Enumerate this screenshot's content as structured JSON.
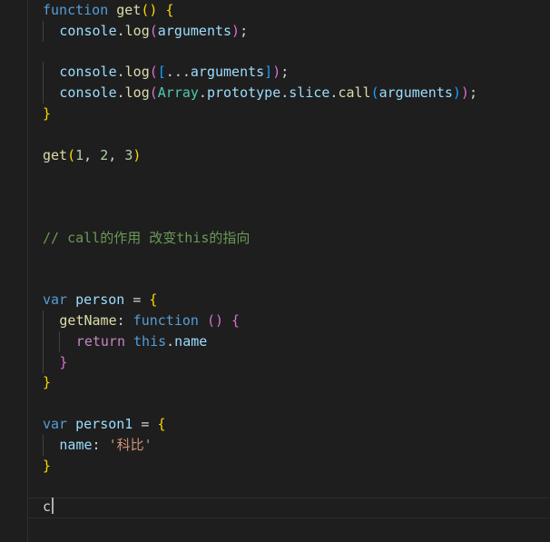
{
  "editor": {
    "language": "javascript",
    "lines": [
      {
        "tokens": [
          {
            "t": "function",
            "c": "kw"
          },
          {
            "t": " ",
            "c": "pl"
          },
          {
            "t": "get",
            "c": "fn"
          },
          {
            "t": "()",
            "c": "p1"
          },
          {
            "t": " ",
            "c": "pl"
          },
          {
            "t": "{",
            "c": "p1"
          }
        ]
      },
      {
        "tokens": [
          {
            "t": "console",
            "c": "var"
          },
          {
            "t": ".",
            "c": "pl"
          },
          {
            "t": "log",
            "c": "fn"
          },
          {
            "t": "(",
            "c": "p2"
          },
          {
            "t": "arguments",
            "c": "var"
          },
          {
            "t": ")",
            "c": "p2"
          },
          {
            "t": ";",
            "c": "pl"
          }
        ]
      },
      {
        "tokens": []
      },
      {
        "tokens": [
          {
            "t": "console",
            "c": "var"
          },
          {
            "t": ".",
            "c": "pl"
          },
          {
            "t": "log",
            "c": "fn"
          },
          {
            "t": "(",
            "c": "p2"
          },
          {
            "t": "[",
            "c": "p3"
          },
          {
            "t": "...",
            "c": "pl"
          },
          {
            "t": "arguments",
            "c": "var"
          },
          {
            "t": "]",
            "c": "p3"
          },
          {
            "t": ")",
            "c": "p2"
          },
          {
            "t": ";",
            "c": "pl"
          }
        ]
      },
      {
        "tokens": [
          {
            "t": "console",
            "c": "var"
          },
          {
            "t": ".",
            "c": "pl"
          },
          {
            "t": "log",
            "c": "fn"
          },
          {
            "t": "(",
            "c": "p2"
          },
          {
            "t": "Array",
            "c": "type"
          },
          {
            "t": ".",
            "c": "pl"
          },
          {
            "t": "prototype",
            "c": "var"
          },
          {
            "t": ".",
            "c": "pl"
          },
          {
            "t": "slice",
            "c": "var"
          },
          {
            "t": ".",
            "c": "pl"
          },
          {
            "t": "call",
            "c": "fn"
          },
          {
            "t": "(",
            "c": "p3"
          },
          {
            "t": "arguments",
            "c": "var"
          },
          {
            "t": ")",
            "c": "p3"
          },
          {
            "t": ")",
            "c": "p2"
          },
          {
            "t": ";",
            "c": "pl"
          }
        ]
      },
      {
        "tokens": [
          {
            "t": "}",
            "c": "p1"
          }
        ]
      },
      {
        "tokens": []
      },
      {
        "tokens": [
          {
            "t": "get",
            "c": "fn"
          },
          {
            "t": "(",
            "c": "p1"
          },
          {
            "t": "1",
            "c": "num"
          },
          {
            "t": ", ",
            "c": "pl"
          },
          {
            "t": "2",
            "c": "num"
          },
          {
            "t": ", ",
            "c": "pl"
          },
          {
            "t": "3",
            "c": "num"
          },
          {
            "t": ")",
            "c": "p1"
          }
        ]
      },
      {
        "tokens": []
      },
      {
        "tokens": []
      },
      {
        "tokens": []
      },
      {
        "tokens": [
          {
            "t": "// call的作用 改变this的指向",
            "c": "cmt"
          }
        ]
      },
      {
        "tokens": []
      },
      {
        "tokens": []
      },
      {
        "tokens": [
          {
            "t": "var",
            "c": "kw"
          },
          {
            "t": " ",
            "c": "pl"
          },
          {
            "t": "person",
            "c": "var"
          },
          {
            "t": " = ",
            "c": "pl"
          },
          {
            "t": "{",
            "c": "p1"
          }
        ]
      },
      {
        "tokens": [
          {
            "t": "getName",
            "c": "fn"
          },
          {
            "t": ": ",
            "c": "pl"
          },
          {
            "t": "function",
            "c": "kw"
          },
          {
            "t": " ",
            "c": "pl"
          },
          {
            "t": "()",
            "c": "p2"
          },
          {
            "t": " ",
            "c": "pl"
          },
          {
            "t": "{",
            "c": "p2"
          }
        ]
      },
      {
        "tokens": [
          {
            "t": "return",
            "c": "kw2"
          },
          {
            "t": " ",
            "c": "pl"
          },
          {
            "t": "this",
            "c": "kw"
          },
          {
            "t": ".",
            "c": "pl"
          },
          {
            "t": "name",
            "c": "var"
          }
        ]
      },
      {
        "tokens": [
          {
            "t": "}",
            "c": "p2"
          }
        ]
      },
      {
        "tokens": [
          {
            "t": "}",
            "c": "p1"
          }
        ]
      },
      {
        "tokens": []
      },
      {
        "tokens": [
          {
            "t": "var",
            "c": "kw"
          },
          {
            "t": " ",
            "c": "pl"
          },
          {
            "t": "person1",
            "c": "var"
          },
          {
            "t": " = ",
            "c": "pl"
          },
          {
            "t": "{",
            "c": "p1"
          }
        ]
      },
      {
        "tokens": [
          {
            "t": "name",
            "c": "var"
          },
          {
            "t": ": ",
            "c": "pl"
          },
          {
            "t": "'科比'",
            "c": "str"
          }
        ]
      },
      {
        "tokens": [
          {
            "t": "}",
            "c": "p1"
          }
        ]
      },
      {
        "tokens": []
      },
      {
        "tokens": [
          {
            "t": "c",
            "c": "pl"
          }
        ],
        "cursor": true
      }
    ]
  }
}
